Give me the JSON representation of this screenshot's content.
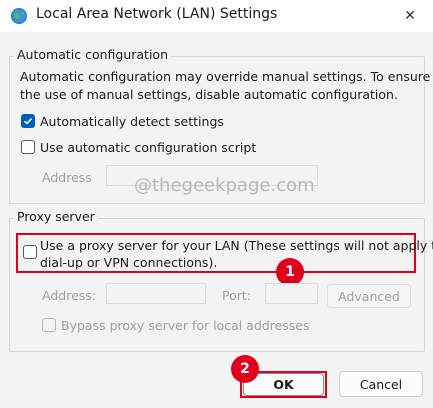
{
  "window": {
    "title": "Local Area Network (LAN) Settings",
    "close_glyph": "✕"
  },
  "auto_config": {
    "group_label": "Automatic configuration",
    "description_line1": "Automatic configuration may override manual settings.  To ensure",
    "description_line2": "the use of manual settings, disable automatic configuration.",
    "auto_detect_label": "Automatically detect settings",
    "auto_detect_checked": true,
    "script_label": "Use automatic configuration script",
    "script_checked": false,
    "address_label": "Address",
    "address_value": ""
  },
  "watermark": "@thegeekpage.com",
  "proxy": {
    "group_label": "Proxy server",
    "use_proxy_line1": "Use a proxy server for your LAN (These settings will not apply to",
    "use_proxy_line2": "dial-up or VPN connections).",
    "use_proxy_checked": false,
    "address_label": "Address:",
    "address_value": "",
    "port_label": "Port:",
    "port_value": "",
    "advanced_label": "Advanced",
    "bypass_label": "Bypass proxy server for local addresses",
    "bypass_checked": false
  },
  "footer": {
    "ok_label": "OK",
    "cancel_label": "Cancel"
  },
  "annotations": {
    "badge1": "1",
    "badge2": "2",
    "highlight_color": "#e0001b"
  },
  "colors": {
    "accent": "#005fb8",
    "window_bg": "#f3f3f3"
  }
}
